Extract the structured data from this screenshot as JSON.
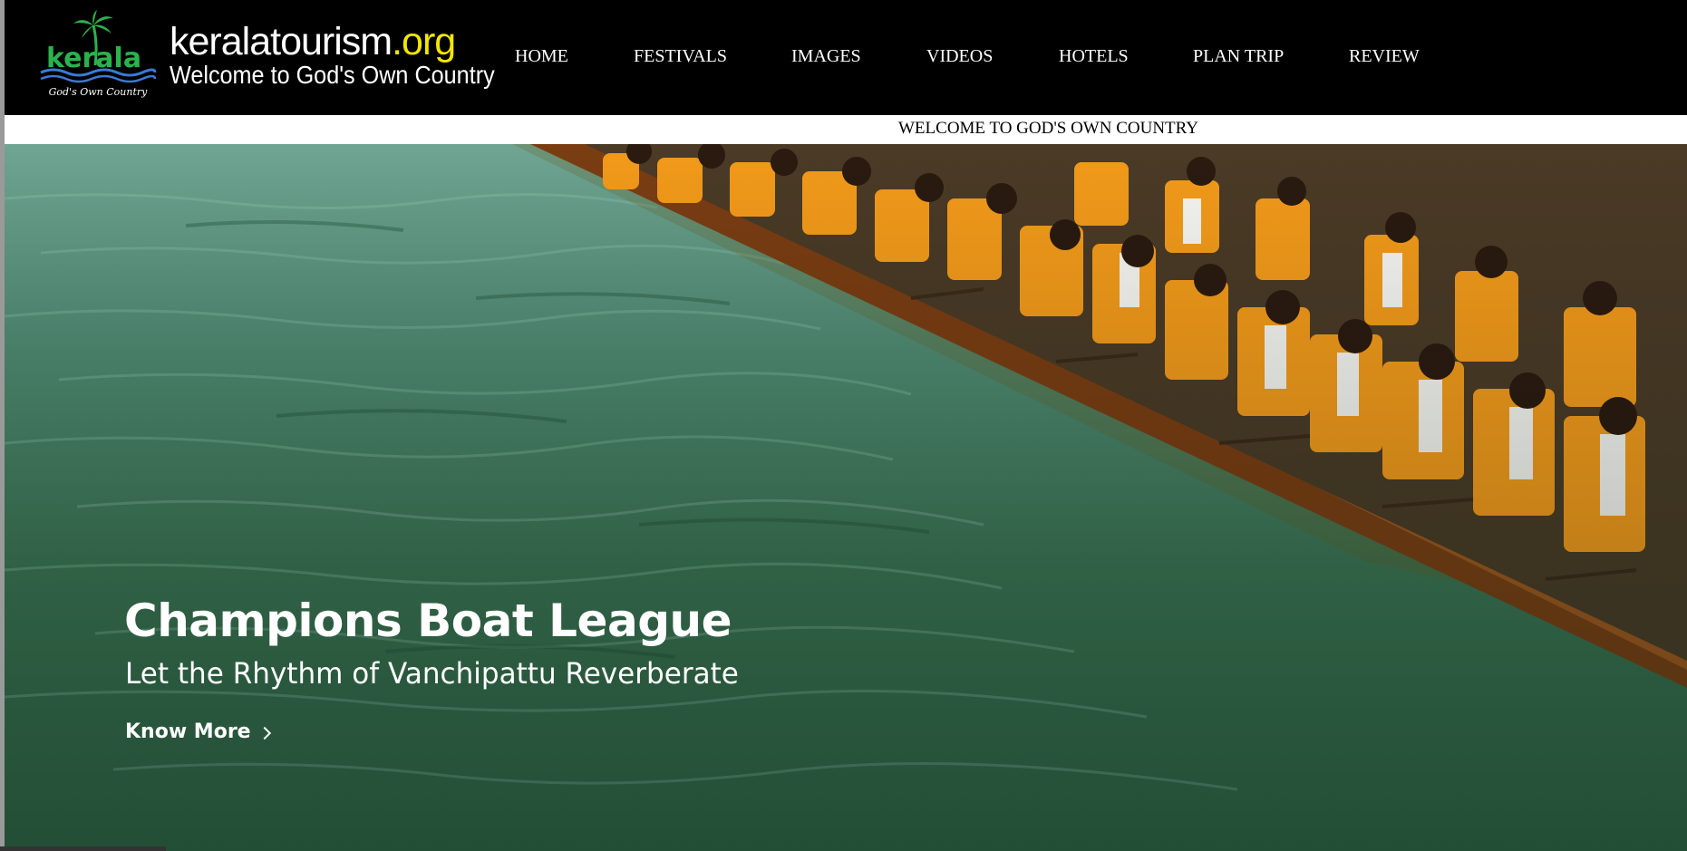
{
  "site": {
    "brand_name": "keralatourism",
    "brand_tld": ".org",
    "tagline": "Welcome to God's Own Country",
    "logo_word": "kerala",
    "logo_caption": "God's Own Country"
  },
  "nav": {
    "items": [
      "HOME",
      "FESTIVALS",
      "IMAGES",
      "VIDEOS",
      "HOTELS",
      "PLAN TRIP",
      "REVIEW"
    ]
  },
  "ticker": {
    "text": "WELCOME TO GOD'S OWN COUNTRY"
  },
  "hero": {
    "title": "Champions Boat League",
    "subtitle": "Let the Rhythm of Vanchipattu Reverberate",
    "cta_label": "Know More"
  },
  "colors": {
    "header_bg": "#000000",
    "tld_yellow": "#f2e600",
    "logo_green": "#2bb24c",
    "water_green": "#3b7454",
    "jersey_orange": "#f29a1a"
  },
  "icons": {
    "logo": "kerala-palm-logo",
    "cta": "chevron-right-icon"
  }
}
